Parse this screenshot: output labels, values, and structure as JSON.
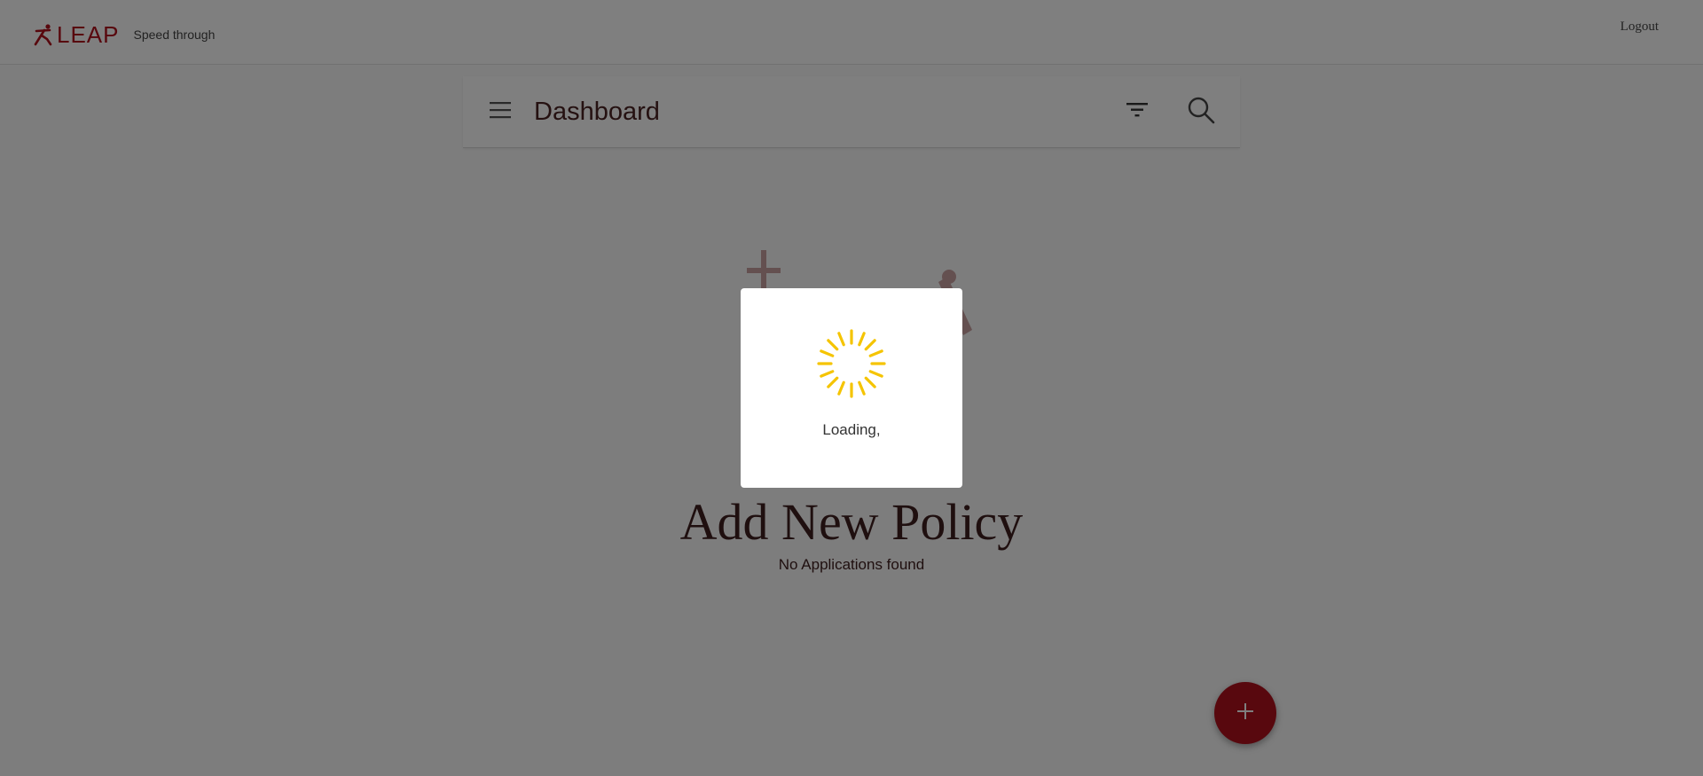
{
  "header": {
    "brand_name": "LEAP",
    "tagline": "Speed through",
    "logout_label": "Logout",
    "brand_color": "#b0101c"
  },
  "toolbar": {
    "title": "Dashboard",
    "menu_icon": "hamburger-icon",
    "filter_icon": "filter-icon",
    "search_icon": "search-icon"
  },
  "empty_state": {
    "title": "Add New Policy",
    "subtitle": "No Applications found"
  },
  "fab": {
    "icon": "plus-icon",
    "color": "#b0101c"
  },
  "loading_modal": {
    "text": "Loading,",
    "spinner_color": "#f5c400"
  }
}
